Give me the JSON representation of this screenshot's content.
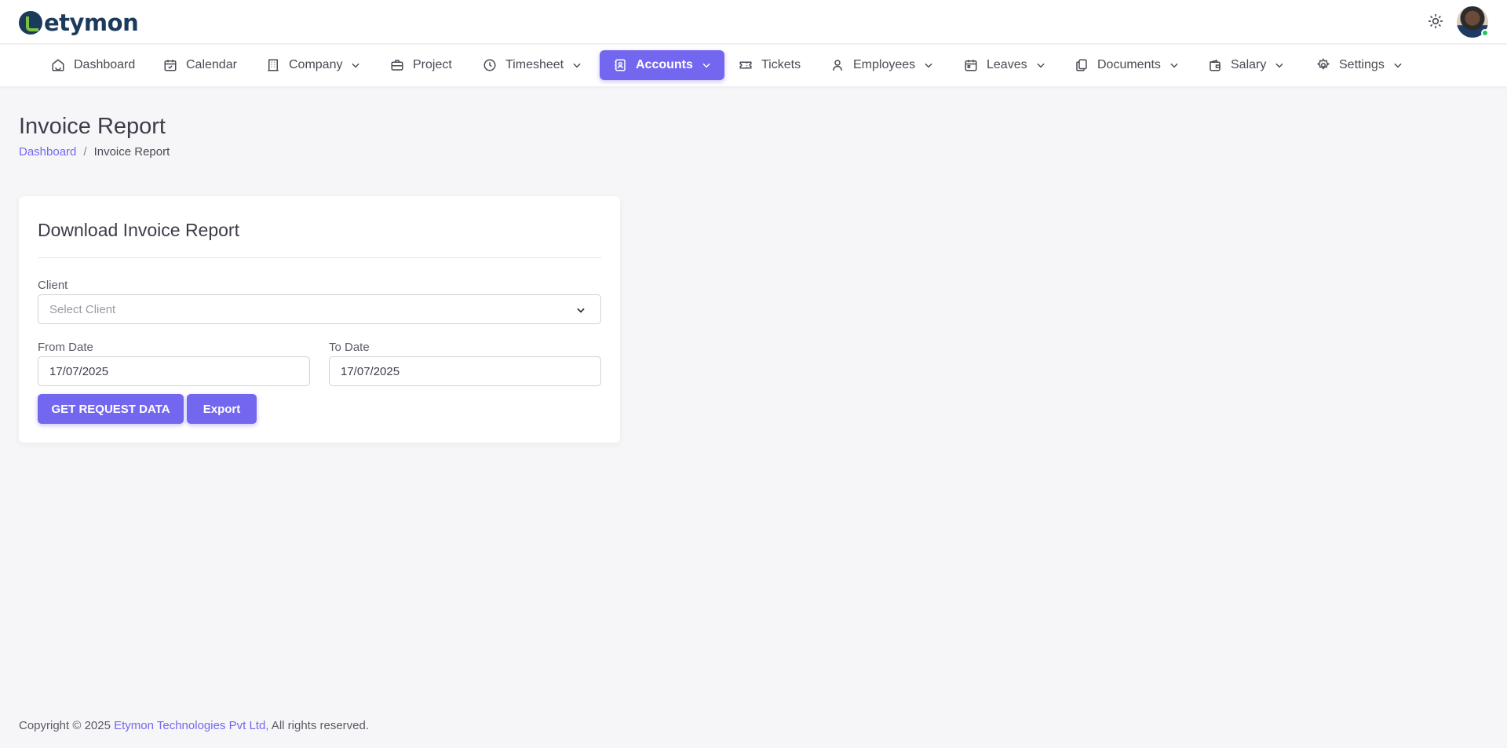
{
  "brand": {
    "name": "etymon"
  },
  "nav": {
    "items": [
      {
        "label": "Dashboard",
        "icon": "home-icon",
        "dropdown": false,
        "active": false
      },
      {
        "label": "Calendar",
        "icon": "calendar-icon",
        "dropdown": false,
        "active": false
      },
      {
        "label": "Company",
        "icon": "building-icon",
        "dropdown": true,
        "active": false
      },
      {
        "label": "Project",
        "icon": "briefcase-icon",
        "dropdown": false,
        "active": false
      },
      {
        "label": "Timesheet",
        "icon": "clock-icon",
        "dropdown": true,
        "active": false
      },
      {
        "label": "Accounts",
        "icon": "ledger-icon",
        "dropdown": true,
        "active": true
      },
      {
        "label": "Tickets",
        "icon": "ticket-icon",
        "dropdown": false,
        "active": false
      },
      {
        "label": "Employees",
        "icon": "user-icon",
        "dropdown": true,
        "active": false
      },
      {
        "label": "Leaves",
        "icon": "calendar-icon",
        "dropdown": true,
        "active": false
      },
      {
        "label": "Documents",
        "icon": "documents-icon",
        "dropdown": true,
        "active": false
      },
      {
        "label": "Salary",
        "icon": "wallet-icon",
        "dropdown": true,
        "active": false
      },
      {
        "label": "Settings",
        "icon": "gear-icon",
        "dropdown": true,
        "active": false
      }
    ]
  },
  "page": {
    "title": "Invoice Report",
    "breadcrumb": {
      "home": "Dashboard",
      "separator": "/",
      "current": "Invoice Report"
    }
  },
  "card": {
    "title": "Download Invoice Report",
    "client": {
      "label": "Client",
      "placeholder": "Select Client"
    },
    "from_date": {
      "label": "From Date",
      "value": "17/07/2025"
    },
    "to_date": {
      "label": "To Date",
      "value": "17/07/2025"
    },
    "get_button": "GET REQUEST DATA",
    "export_button": "Export"
  },
  "footer": {
    "prefix": "Copyright © 2025 ",
    "company": "Etymon Technologies Pvt Ltd,",
    "suffix": " All rights reserved."
  },
  "colors": {
    "accent": "#7367f0",
    "brand": "#1c3a5c",
    "status_online": "#22c55e"
  }
}
